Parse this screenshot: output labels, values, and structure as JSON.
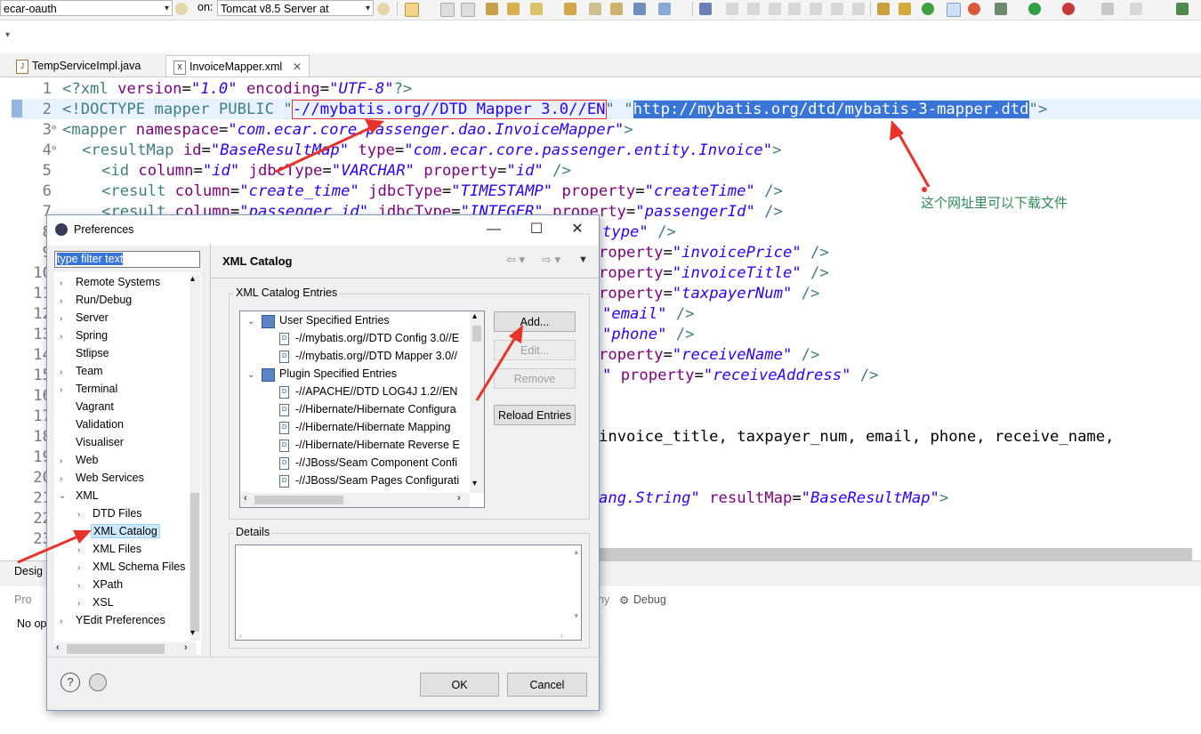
{
  "toolbar": {
    "project_combo": "ecar-oauth",
    "on_label": "on:",
    "server_combo": "Tomcat v8.5 Server at"
  },
  "editor_tabs": [
    {
      "label": "TempServiceImpl.java"
    },
    {
      "label": "InvoiceMapper.xml"
    }
  ],
  "code": {
    "line_numbers": [
      "1",
      "2",
      "3",
      "4",
      "5",
      "6",
      "7",
      "8",
      "9",
      "10",
      "11",
      "12",
      "13",
      "14",
      "15",
      "16",
      "17",
      "18",
      "19",
      "20",
      "21",
      "22",
      "23"
    ],
    "line1": {
      "pi": "<?xml ",
      "attr1": "version",
      "eq": "=",
      "val1": "\"1.0\"",
      "attr2": " encoding",
      "val2": "\"UTF-8\"",
      "end": "?>"
    },
    "line2": {
      "start": "<!DOCTYPE mapper PUBLIC \"",
      "boxed": "-//mybatis.org//DTD Mapper 3.0//EN",
      "mid": "\" \"",
      "selected": "http://mybatis.org/dtd/mybatis-3-mapper.dtd",
      "end": "\">"
    },
    "line3": {
      "tag": "<mapper ",
      "attr": "namespace",
      "val": "\"com.ecar.core.passenger.dao.InvoiceMapper\"",
      "end": ">"
    },
    "line4": {
      "tag": "<resultMap ",
      "attr1": "id",
      "val1": "\"BaseResultMap\"",
      "attr2": " type",
      "val2": "\"com.ecar.core.passenger.entity.Invoice\"",
      "end": ">"
    },
    "line5": {
      "tag": "<id ",
      "attr1": "column",
      "val1": "\"id\"",
      "attr2": " jdbcType",
      "val2": "\"VARCHAR\"",
      "attr3": " property",
      "val3": "\"id\"",
      "end": " />"
    },
    "line6": {
      "tag": "<result ",
      "attr1": "column",
      "val1": "\"create_time\"",
      "attr2": " jdbcType",
      "val2": "\"TIMESTAMP\"",
      "attr3": " property",
      "val3": "\"createTime\"",
      "end": " />"
    },
    "line7": {
      "tag": "<result ",
      "attr1": "column",
      "val1": "\"passenger_id\"",
      "attr2": " jdbcType",
      "val2": "\"INTEGER\"",
      "attr3": " property",
      "val3": "\"passengerId\"",
      "end": " />"
    },
    "line8_tail": {
      "val": "type\"",
      "end": " />"
    },
    "line9_tail": {
      "attr": "roperty",
      "val": "\"invoicePrice\"",
      "end": " />"
    },
    "line10_tail": {
      "attr": "roperty",
      "val": "\"invoiceTitle\"",
      "end": " />"
    },
    "line11_tail": {
      "attr": "roperty",
      "val": "\"taxpayerNum\"",
      "end": " />"
    },
    "line12_tail": {
      "val": "\"email\"",
      "end": " />"
    },
    "line13_tail": {
      "val": "\"phone\"",
      "end": " />"
    },
    "line14_tail": {
      "attr": "roperty",
      "val": "\"receiveName\"",
      "end": " />"
    },
    "line15_tail": {
      "attr": "property",
      "val": "\"receiveAddress\"",
      "end": " />"
    },
    "line18_tail": "invoice_title, taxpayer_num, email, phone, receive_name,",
    "line21_tail": {
      "val": "ang.String\"",
      "attr": " resultMap",
      "val2": "\"BaseResultMap\"",
      "end": ">"
    }
  },
  "annotation": "这个网址里可以下载文件",
  "bottom_views": {
    "design_tab": "Desig",
    "pro_tab": "Pro",
    "debug_tab": "Debug",
    "no_op": "No op",
    "ny": "ny"
  },
  "preferences": {
    "title": "Preferences",
    "filter_text": "type filter text",
    "tree_items": [
      {
        "label": "Remote Systems",
        "expandable": true
      },
      {
        "label": "Run/Debug",
        "expandable": true
      },
      {
        "label": "Server",
        "expandable": true
      },
      {
        "label": "Spring",
        "expandable": true
      },
      {
        "label": "Stlipse",
        "expandable": false
      },
      {
        "label": "Team",
        "expandable": true
      },
      {
        "label": "Terminal",
        "expandable": true
      },
      {
        "label": "Vagrant",
        "expandable": false
      },
      {
        "label": "Validation",
        "expandable": false
      },
      {
        "label": "Visualiser",
        "expandable": false
      },
      {
        "label": "Web",
        "expandable": true
      },
      {
        "label": "Web Services",
        "expandable": true
      },
      {
        "label": "XML",
        "expandable": true,
        "expanded": true
      },
      {
        "label": "DTD Files",
        "expandable": true,
        "child": true
      },
      {
        "label": "XML Catalog",
        "expandable": false,
        "child": true,
        "selected": true
      },
      {
        "label": "XML Files",
        "expandable": true,
        "child": true
      },
      {
        "label": "XML Schema Files",
        "expandable": true,
        "child": true
      },
      {
        "label": "XPath",
        "expandable": true,
        "child": true
      },
      {
        "label": "XSL",
        "expandable": true,
        "child": true
      },
      {
        "label": "YEdit Preferences",
        "expandable": true
      }
    ],
    "page_title": "XML Catalog",
    "entries_label": "XML Catalog Entries",
    "catalog": [
      {
        "label": "User Specified Entries",
        "group": true
      },
      {
        "label": "-//mybatis.org//DTD Config 3.0//E"
      },
      {
        "label": "-//mybatis.org//DTD Mapper 3.0//"
      },
      {
        "label": "Plugin Specified Entries",
        "group": true
      },
      {
        "label": "-//APACHE//DTD LOG4J 1.2//EN"
      },
      {
        "label": "-//Hibernate/Hibernate Configura"
      },
      {
        "label": "-//Hibernate/Hibernate Mapping"
      },
      {
        "label": "-//Hibernate/Hibernate Reverse E"
      },
      {
        "label": "-//JBoss/Seam Component Confi"
      },
      {
        "label": "-//JBoss/Seam Pages Configurati"
      }
    ],
    "buttons": {
      "add": "Add...",
      "edit": "Edit...",
      "remove": "Remove",
      "reload": "Reload Entries"
    },
    "details_label": "Details",
    "ok": "OK",
    "cancel": "Cancel"
  },
  "colors": {
    "selection": "#3875d7",
    "arrow": "#e8322a",
    "annotation": "#2e8b57"
  }
}
